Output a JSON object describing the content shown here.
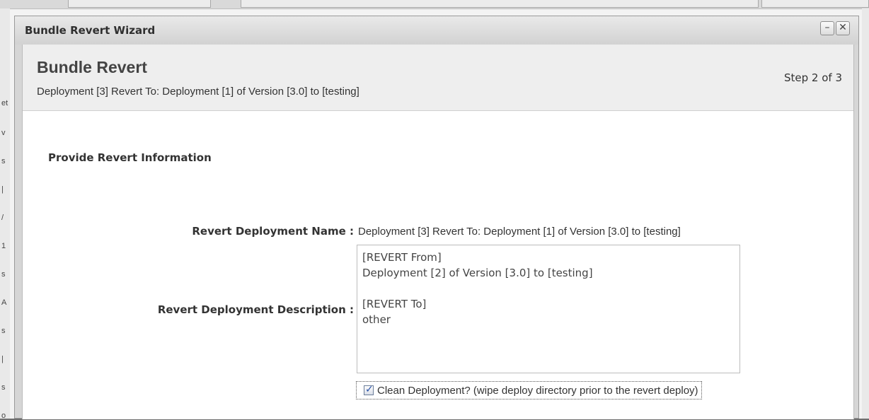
{
  "background": {
    "left_fragments": [
      "et",
      "v",
      "s",
      "|",
      "/",
      "1",
      "s",
      "A",
      "s",
      "|",
      "s",
      "o"
    ]
  },
  "dialog": {
    "title": "Bundle Revert Wizard",
    "minimize_symbol": "–",
    "close_symbol": "✕"
  },
  "wizard": {
    "title": "Bundle Revert",
    "subtitle": "Deployment [3] Revert To: Deployment [1] of Version [3.0] to [testing]",
    "step": "Step 2 of 3"
  },
  "form": {
    "section_title": "Provide Revert Information",
    "name_label": "Revert Deployment Name :",
    "name_value": "Deployment [3] Revert To: Deployment [1] of Version [3.0] to [testing]",
    "description_label": "Revert Deployment Description :",
    "description_value": "[REVERT From]\nDeployment [2] of Version [3.0] to [testing]\n\n[REVERT To]\nother",
    "clean_label": "Clean Deployment? (wipe deploy directory prior to the revert deploy)",
    "clean_checked": true,
    "check_glyph": "✓"
  },
  "colors": {
    "header_bg": "#eeeeee",
    "dialog_frame": "#d6d6d6",
    "check_mark": "#2650a8"
  }
}
